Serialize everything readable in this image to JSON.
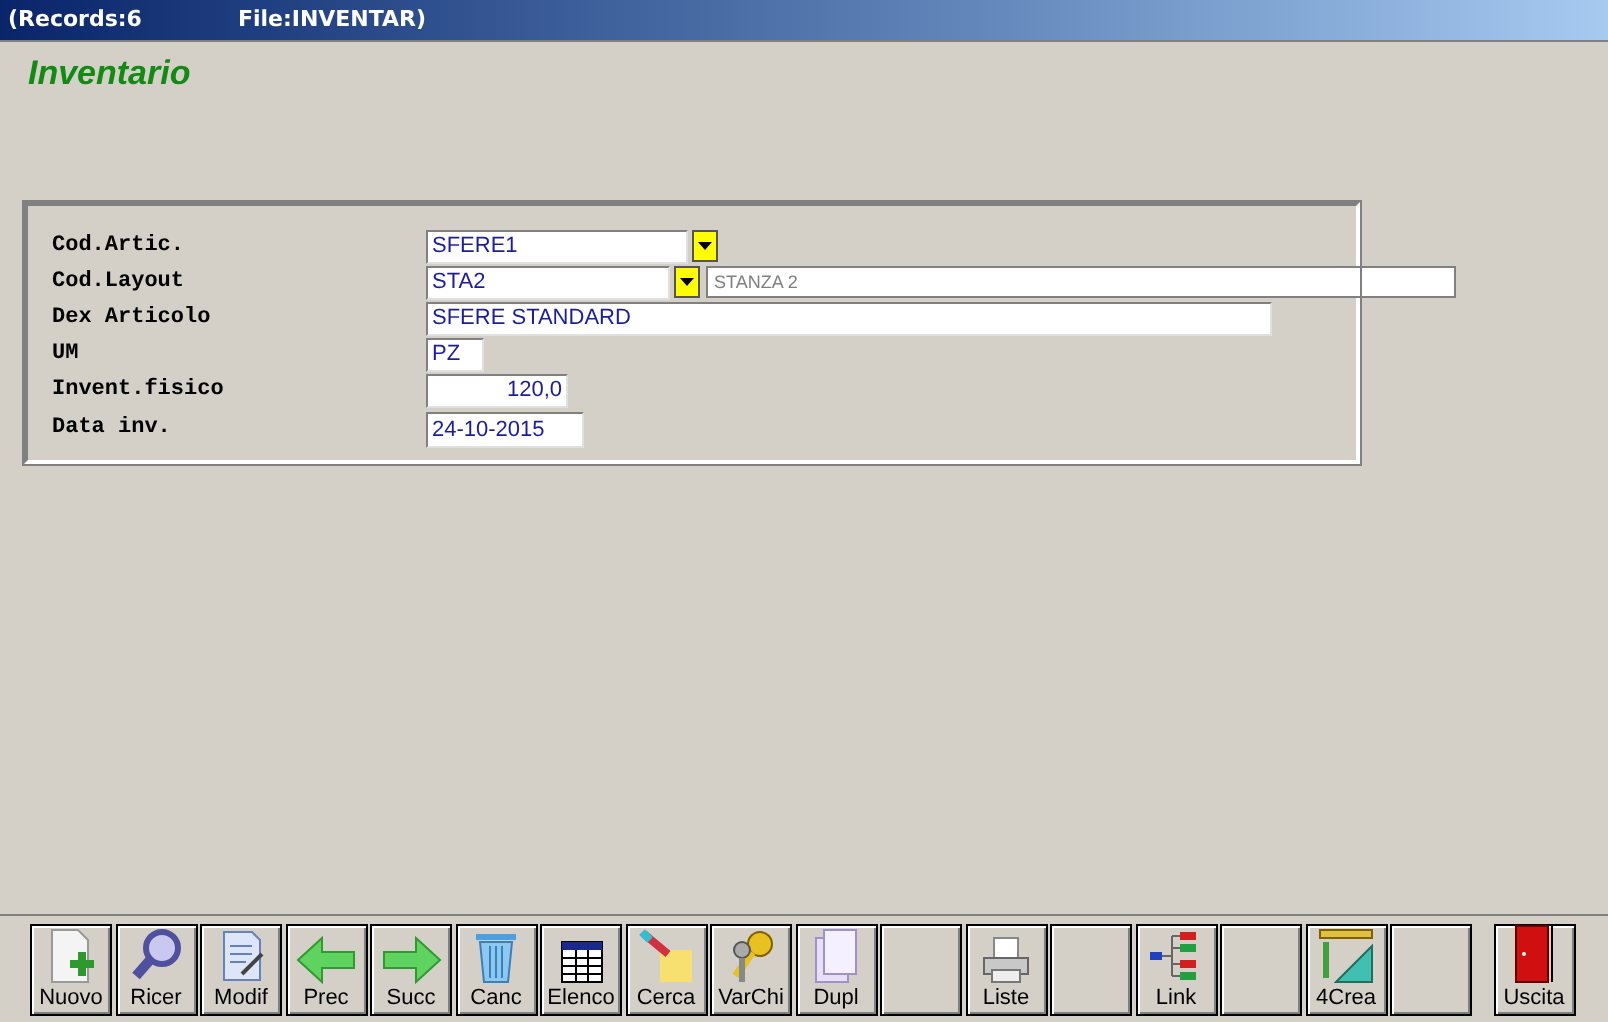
{
  "window": {
    "title_records": "(Records:6",
    "title_file": "File:INVENTAR)"
  },
  "heading": "Inventario",
  "fields": [
    {
      "label": "Cod.Artic.",
      "kind": "combo",
      "value": "SFERE1"
    },
    {
      "label": "Cod.Layout",
      "kind": "combo",
      "value": "STA2",
      "description": "STANZA 2"
    },
    {
      "label": "Dex Articolo",
      "kind": "text",
      "value": "SFERE STANDARD"
    },
    {
      "label": "UM",
      "kind": "short",
      "value": "PZ"
    },
    {
      "label": "Invent.fisico",
      "kind": "number",
      "value": "120,0"
    },
    {
      "label": "Data inv.",
      "kind": "date",
      "value": "24-10-2015"
    }
  ],
  "toolbar": [
    {
      "kind": "button",
      "label": "Nuovo"
    },
    {
      "kind": "button",
      "label": "Ricer"
    },
    {
      "kind": "button",
      "label": "Modif"
    },
    {
      "kind": "button",
      "label": "Prec"
    },
    {
      "kind": "button",
      "label": "Succ"
    },
    {
      "kind": "button",
      "label": "Canc"
    },
    {
      "kind": "button",
      "label": "Elenco"
    },
    {
      "kind": "button",
      "label": "Cerca"
    },
    {
      "kind": "button",
      "label": "VarChi"
    },
    {
      "kind": "button",
      "label": "Dupl"
    },
    {
      "kind": "blank"
    },
    {
      "kind": "button",
      "label": "Liste"
    },
    {
      "kind": "blank"
    },
    {
      "kind": "button",
      "label": "Link"
    },
    {
      "kind": "blank"
    },
    {
      "kind": "button",
      "label": "4Crea"
    },
    {
      "kind": "blank"
    },
    {
      "kind": "exit",
      "label": "Uscita"
    }
  ]
}
